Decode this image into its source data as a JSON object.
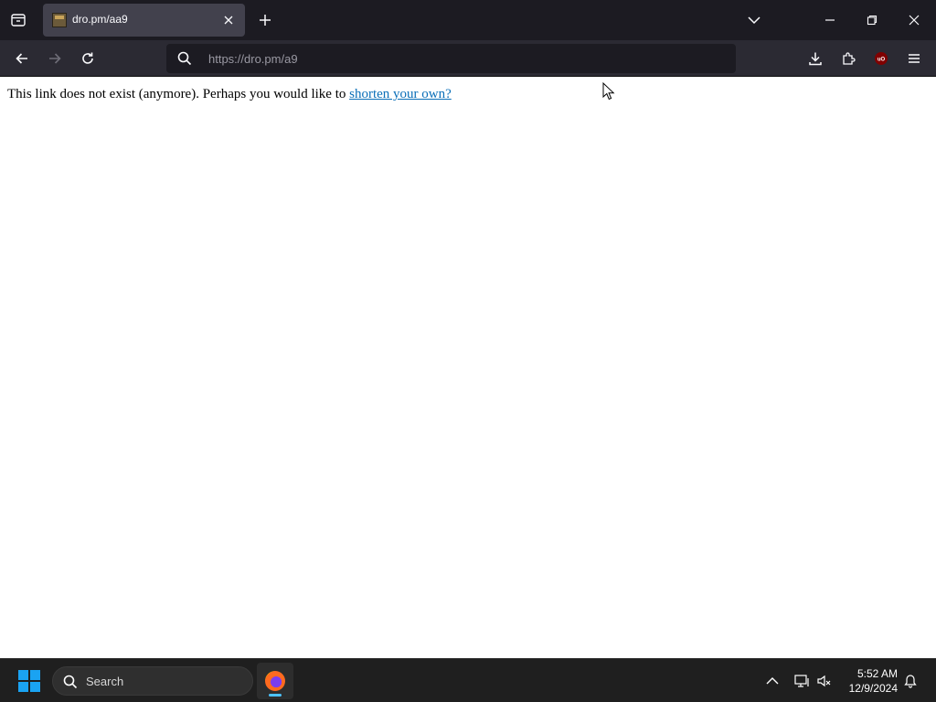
{
  "browser": {
    "tab": {
      "title": "dro.pm/aa9"
    },
    "url": "https://dro.pm/a9"
  },
  "page": {
    "message": "This link does not exist (anymore). Perhaps you would like to ",
    "link_text": "shorten your own?"
  },
  "taskbar": {
    "search_label": "Search",
    "time": "5:52 AM",
    "date": "12/9/2024"
  },
  "colors": {
    "tabbar_bg": "#1c1b22",
    "navbar_bg": "#2b2a33",
    "active_tab_bg": "#42414d",
    "link": "#0b6fb8",
    "taskbar_bg": "#1f1f1f",
    "windows_accent": "#1aa3f2"
  },
  "icons": [
    "tab-overview-icon",
    "close-icon",
    "plus-icon",
    "chevron-down-icon",
    "minimize-icon",
    "restore-icon",
    "window-close-icon",
    "back-arrow-icon",
    "forward-arrow-icon",
    "reload-icon",
    "search-icon",
    "download-icon",
    "extensions-icon",
    "ublock-icon",
    "hamburger-menu-icon",
    "windows-start-icon",
    "firefox-icon",
    "chevron-up-icon",
    "network-icon",
    "volume-muted-icon",
    "bell-icon"
  ]
}
